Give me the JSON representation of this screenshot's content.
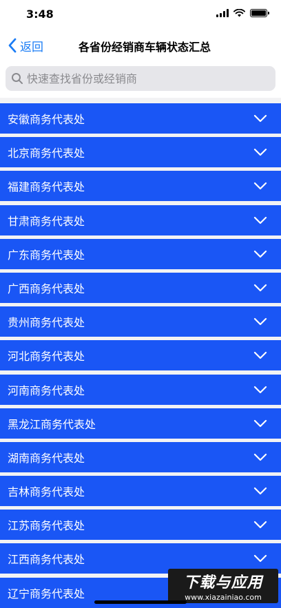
{
  "status_bar": {
    "time": "3:48"
  },
  "nav": {
    "back_label": "返回",
    "title": "各省份经销商车辆状态汇总"
  },
  "search": {
    "placeholder": "快速查找省份或经销商"
  },
  "list": {
    "items": [
      {
        "label": "安徽商务代表处"
      },
      {
        "label": "北京商务代表处"
      },
      {
        "label": "福建商务代表处"
      },
      {
        "label": "甘肃商务代表处"
      },
      {
        "label": "广东商务代表处"
      },
      {
        "label": "广西商务代表处"
      },
      {
        "label": "贵州商务代表处"
      },
      {
        "label": "河北商务代表处"
      },
      {
        "label": "河南商务代表处"
      },
      {
        "label": "黑龙江商务代表处"
      },
      {
        "label": "湖南商务代表处"
      },
      {
        "label": "吉林商务代表处"
      },
      {
        "label": "江苏商务代表处"
      },
      {
        "label": "江西商务代表处"
      },
      {
        "label": "辽宁商务代表处"
      }
    ]
  },
  "watermark": {
    "title": "下载与应用",
    "url": "www.xiazainiao.com"
  },
  "colors": {
    "accent": "#1a7cf5",
    "list_item_bg": "#1a56f5",
    "list_item_text": "#ffffff"
  }
}
